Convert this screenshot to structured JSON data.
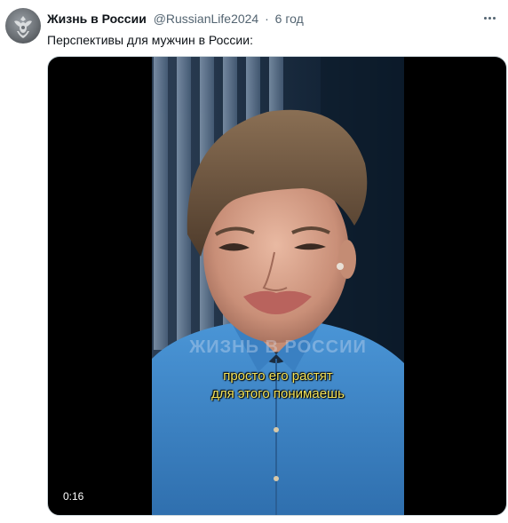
{
  "author": {
    "display_name": "Жизнь в России",
    "handle": "@RussianLife2024",
    "separator": "·",
    "time": "6 год",
    "avatar_icon": "coat-of-arms-icon"
  },
  "tweet": {
    "text": "Перспективы для мужчин в России:"
  },
  "video": {
    "watermark": "ЖИЗНЬ В РОССИИ",
    "subtitle_line1": "просто его растят",
    "subtitle_line2": "для этого понимаешь",
    "duration": "0:16"
  },
  "colors": {
    "text": "#0f1419",
    "secondary": "#536471",
    "subtitle": "#f3e35a",
    "shirt": "#3f86c9"
  }
}
